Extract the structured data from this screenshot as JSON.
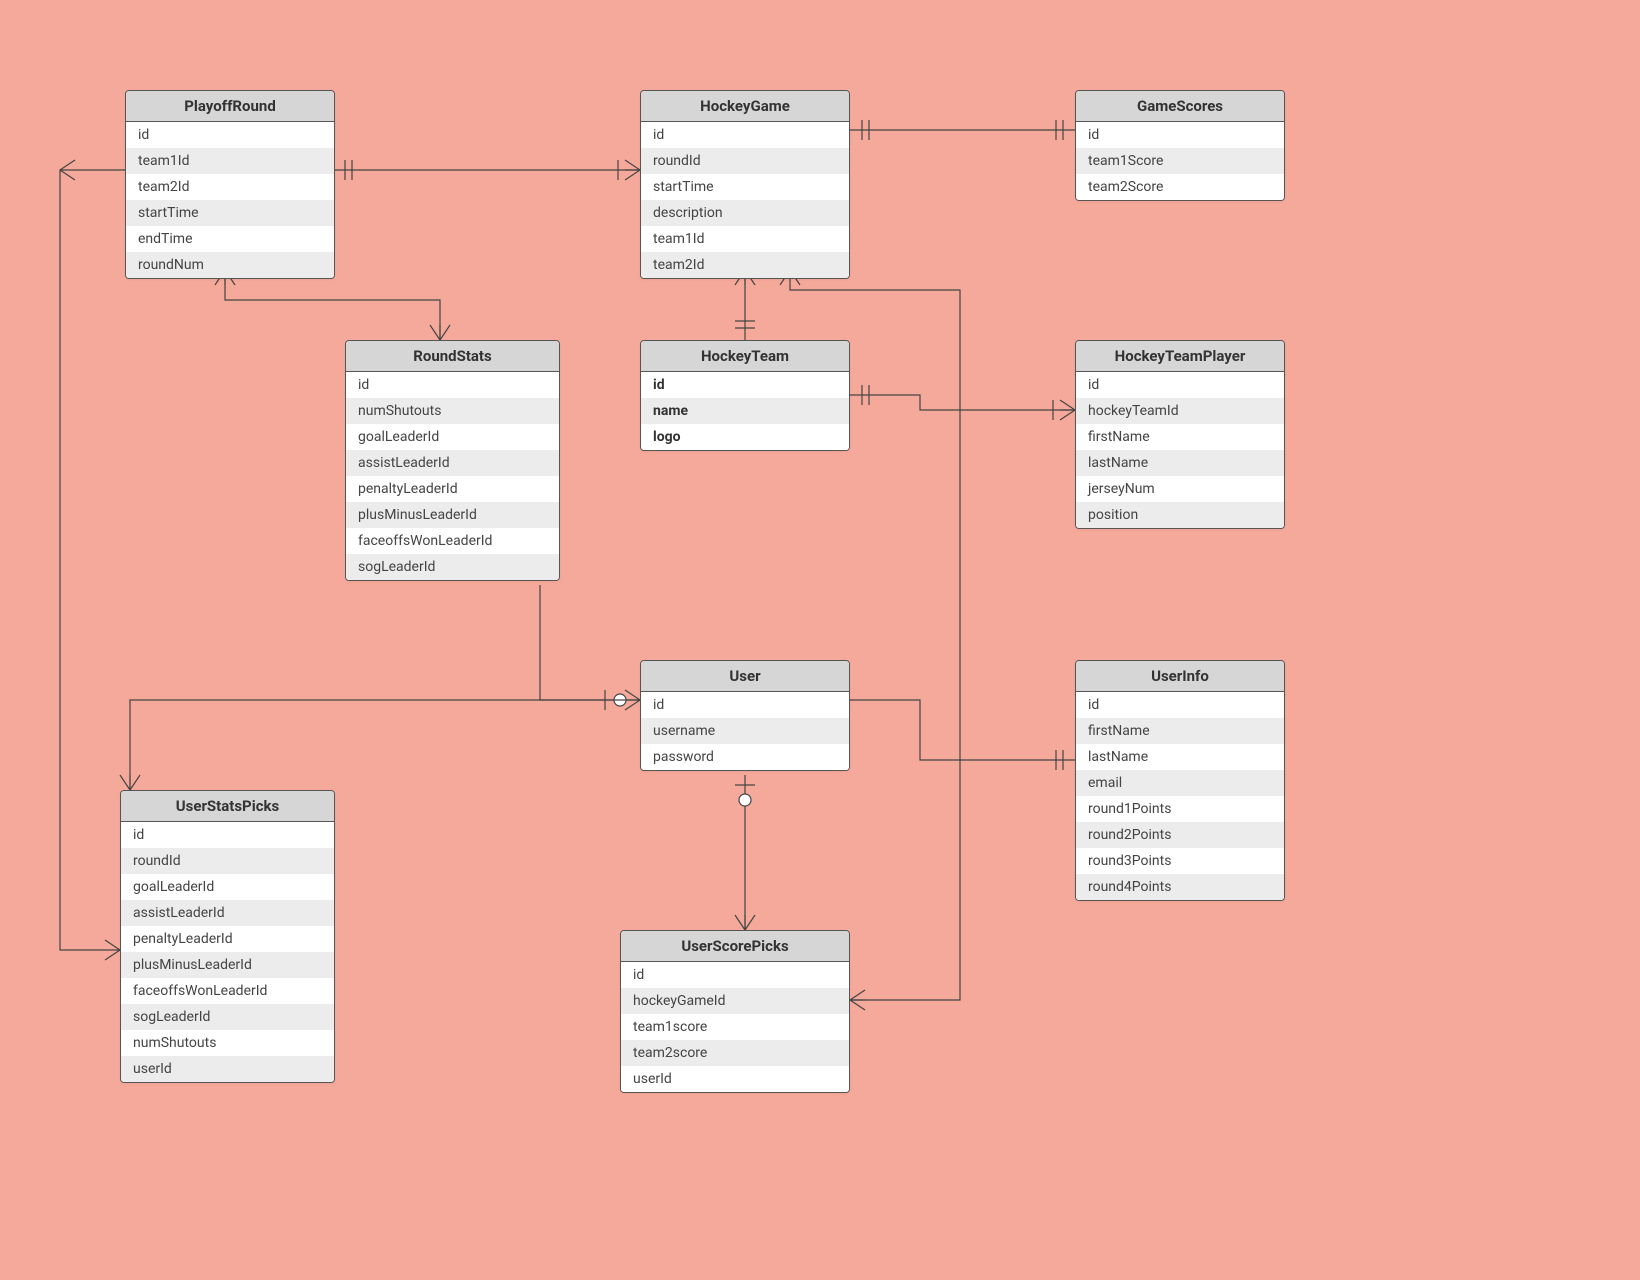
{
  "entities": {
    "playoffRound": {
      "title": "PlayoffRound",
      "fields": [
        "id",
        "team1Id",
        "team2Id",
        "startTime",
        "endTime",
        "roundNum"
      ]
    },
    "hockeyGame": {
      "title": "HockeyGame",
      "fields": [
        "id",
        "roundId",
        "startTime",
        "description",
        "team1Id",
        "team2Id"
      ]
    },
    "gameScores": {
      "title": "GameScores",
      "fields": [
        "id",
        "team1Score",
        "team2Score"
      ]
    },
    "roundStats": {
      "title": "RoundStats",
      "fields": [
        "id",
        "numShutouts",
        "goalLeaderId",
        "assistLeaderId",
        "penaltyLeaderId",
        "plusMinusLeaderId",
        "faceoffsWonLeaderId",
        "sogLeaderId"
      ]
    },
    "hockeyTeam": {
      "title": "HockeyTeam",
      "fields": [
        "id",
        "name",
        "logo"
      ],
      "bold": true
    },
    "hockeyTeamPlayer": {
      "title": "HockeyTeamPlayer",
      "fields": [
        "id",
        "hockeyTeamId",
        "firstName",
        "lastName",
        "jerseyNum",
        "position"
      ]
    },
    "user": {
      "title": "User",
      "fields": [
        "id",
        "username",
        "password"
      ]
    },
    "userInfo": {
      "title": "UserInfo",
      "fields": [
        "id",
        "firstName",
        "lastName",
        "email",
        "round1Points",
        "round2Points",
        "round3Points",
        "round4Points"
      ]
    },
    "userStatsPicks": {
      "title": "UserStatsPicks",
      "fields": [
        "id",
        "roundId",
        "goalLeaderId",
        "assistLeaderId",
        "penaltyLeaderId",
        "plusMinusLeaderId",
        "faceoffsWonLeaderId",
        "sogLeaderId",
        "numShutouts",
        "userId"
      ]
    },
    "userScorePicks": {
      "title": "UserScorePicks",
      "fields": [
        "id",
        "hockeyGameId",
        "team1score",
        "team2score",
        "userId"
      ]
    }
  },
  "relations": [
    {
      "from": "PlayoffRound",
      "to": "HockeyGame",
      "card": "1:N"
    },
    {
      "from": "HockeyGame",
      "to": "GameScores",
      "card": "1:1"
    },
    {
      "from": "PlayoffRound",
      "to": "RoundStats",
      "card": "1:N"
    },
    {
      "from": "HockeyGame",
      "to": "HockeyTeam",
      "card": "N:1"
    },
    {
      "from": "HockeyTeam",
      "to": "HockeyTeamPlayer",
      "card": "1:N"
    },
    {
      "from": "User",
      "to": "UserInfo",
      "card": "1:1"
    },
    {
      "from": "User",
      "to": "UserScorePicks",
      "card": "0..1:N"
    },
    {
      "from": "User",
      "to": "UserStatsPicks",
      "card": "0..1:N"
    },
    {
      "from": "UserStatsPicks",
      "to": "PlayoffRound",
      "card": "N:1"
    },
    {
      "from": "UserScorePicks",
      "to": "HockeyGame",
      "card": "N:1"
    },
    {
      "from": "RoundStats",
      "to": "PlayoffRound",
      "card": "N:1"
    }
  ]
}
